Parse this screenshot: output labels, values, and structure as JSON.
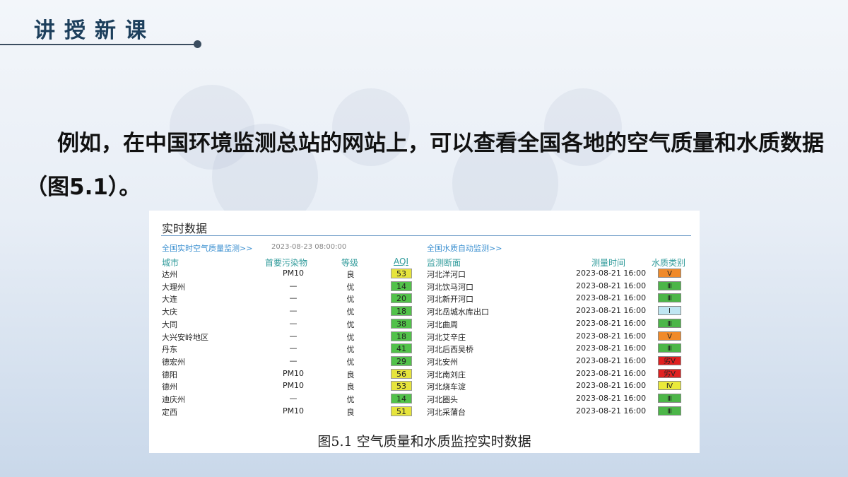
{
  "header": {
    "title": "讲授新课"
  },
  "body_text": "例如，在中国环境监测总站的网站上，可以查看全国各地的空气质量和水质数据（图5.1）。",
  "figure": {
    "title": "实时数据",
    "air_link": "全国实时空气质量监测>>",
    "air_timestamp": "2023-08-23 08:00:00",
    "water_link": "全国水质自动监测>>",
    "headers": {
      "city": "城市",
      "pollutant": "首要污染物",
      "level": "等级",
      "aqi": "AQI",
      "site": "监测断面",
      "time": "测量时间",
      "water_class": "水质类别"
    },
    "rows": [
      {
        "city": "达州",
        "pollutant": "PM10",
        "level": "良",
        "aqi": "53",
        "aqi_color": "#e6e43c",
        "site": "河北洋河口",
        "time": "2023-08-21 16:00",
        "wq": "Ⅴ",
        "wq_color": "#f08a2a"
      },
      {
        "city": "大理州",
        "pollutant": "—",
        "level": "优",
        "aqi": "14",
        "aqi_color": "#52c24a",
        "site": "河北饮马河口",
        "time": "2023-08-21 16:00",
        "wq": "Ⅲ",
        "wq_color": "#4cb648"
      },
      {
        "city": "大连",
        "pollutant": "—",
        "level": "优",
        "aqi": "20",
        "aqi_color": "#52c24a",
        "site": "河北新开河口",
        "time": "2023-08-21 16:00",
        "wq": "Ⅲ",
        "wq_color": "#4cb648"
      },
      {
        "city": "大庆",
        "pollutant": "—",
        "level": "优",
        "aqi": "18",
        "aqi_color": "#52c24a",
        "site": "河北岳城水库出口",
        "time": "2023-08-21 16:00",
        "wq": "Ⅰ",
        "wq_color": "#bfe6f2"
      },
      {
        "city": "大同",
        "pollutant": "—",
        "level": "优",
        "aqi": "38",
        "aqi_color": "#52c24a",
        "site": "河北曲周",
        "time": "2023-08-21 16:00",
        "wq": "Ⅲ",
        "wq_color": "#4cb648"
      },
      {
        "city": "大兴安岭地区",
        "pollutant": "—",
        "level": "优",
        "aqi": "18",
        "aqi_color": "#52c24a",
        "site": "河北艾辛庄",
        "time": "2023-08-21 16:00",
        "wq": "Ⅴ",
        "wq_color": "#f08a2a"
      },
      {
        "city": "丹东",
        "pollutant": "—",
        "level": "优",
        "aqi": "41",
        "aqi_color": "#52c24a",
        "site": "河北后西吴桥",
        "time": "2023-08-21 16:00",
        "wq": "Ⅲ",
        "wq_color": "#4cb648"
      },
      {
        "city": "德宏州",
        "pollutant": "—",
        "level": "优",
        "aqi": "29",
        "aqi_color": "#52c24a",
        "site": "河北安州",
        "time": "2023-08-21 16:00",
        "wq": "劣Ⅴ",
        "wq_color": "#e02020"
      },
      {
        "city": "德阳",
        "pollutant": "PM10",
        "level": "良",
        "aqi": "56",
        "aqi_color": "#e6e43c",
        "site": "河北南刘庄",
        "time": "2023-08-21 16:00",
        "wq": "劣Ⅴ",
        "wq_color": "#e02020"
      },
      {
        "city": "德州",
        "pollutant": "PM10",
        "level": "良",
        "aqi": "53",
        "aqi_color": "#e6e43c",
        "site": "河北烧车淀",
        "time": "2023-08-21 16:00",
        "wq": "Ⅳ",
        "wq_color": "#eaea3a"
      },
      {
        "city": "迪庆州",
        "pollutant": "—",
        "level": "优",
        "aqi": "14",
        "aqi_color": "#52c24a",
        "site": "河北圈头",
        "time": "2023-08-21 16:00",
        "wq": "Ⅲ",
        "wq_color": "#4cb648"
      },
      {
        "city": "定西",
        "pollutant": "PM10",
        "level": "良",
        "aqi": "51",
        "aqi_color": "#e6e43c",
        "site": "河北采蒲台",
        "time": "2023-08-21 16:00",
        "wq": "Ⅲ",
        "wq_color": "#4cb648"
      }
    ],
    "caption": "图5.1  空气质量和水质监控实时数据"
  }
}
